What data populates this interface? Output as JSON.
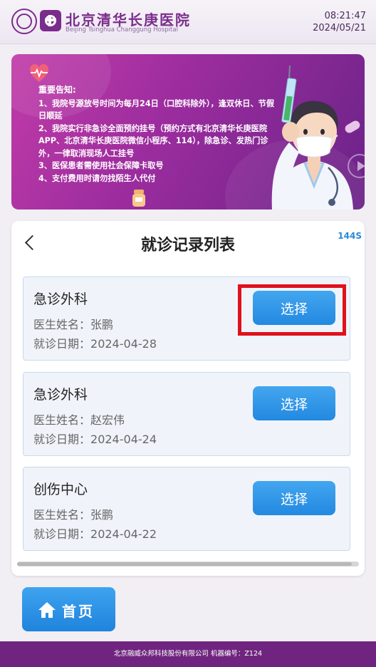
{
  "header": {
    "hospital_name_cn": "北京清华长庚医院",
    "hospital_name_en": "Beijing Tsinghua Changgung Hospital",
    "time": "08:21:47",
    "date": "2024/05/21",
    "seal_icon": "university-seal-icon",
    "logo_icon": "hospital-cross-logo-icon"
  },
  "notice": {
    "title": "重要告知:",
    "items": [
      "1、我院号源放号时间为每月24日（口腔科除外），逢双休日、节假日顺延",
      "2、我院实行非急诊全面预约挂号（预约方式有北京清华长庚医院APP、北京清华长庚医院微信小程序、114），除急诊、发热门诊外，一律取消现场人工挂号",
      "3、医保患者需使用社会保障卡取号",
      "4、支付费用时请勿找陌生人代付"
    ]
  },
  "records": {
    "title": "就诊记录列表",
    "countdown": "144S",
    "doctor_prefix": "医生姓名：",
    "date_prefix": "就诊日期：",
    "select_label": "选择",
    "items": [
      {
        "department": "急诊外科",
        "doctor": "张鹏",
        "date": "2024-04-28",
        "highlighted": true
      },
      {
        "department": "急诊外科",
        "doctor": "赵宏伟",
        "date": "2024-04-24",
        "highlighted": false
      },
      {
        "department": "创伤中心",
        "doctor": "张鹏",
        "date": "2024-04-22",
        "highlighted": false
      }
    ]
  },
  "home_button": {
    "label": "首页",
    "icon": "home-icon"
  },
  "footer": {
    "text": "北京融威众邦科技股份有限公司 机器编号：Z124"
  },
  "colors": {
    "brand_purple": "#7b2d8b",
    "button_blue": "#2389e1",
    "highlight_red": "#e0111a",
    "countdown_blue": "#2a8ad6"
  }
}
